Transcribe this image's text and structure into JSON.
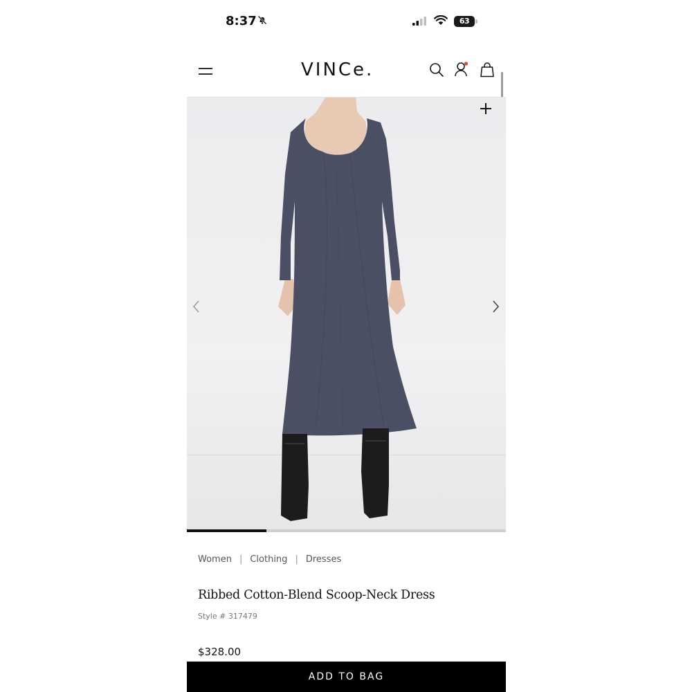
{
  "status_bar": {
    "time": "8:37",
    "battery": "63",
    "mute_icon": "bell-slash-icon",
    "signal_icon": "cellular-signal-icon",
    "wifi_icon": "wifi-icon"
  },
  "header": {
    "logo": "VINCe.",
    "menu_icon": "hamburger-menu-icon",
    "search_icon": "search-icon",
    "account_icon": "account-icon",
    "bag_icon": "shopping-bag-icon",
    "account_badge_color": "#e0443d"
  },
  "gallery": {
    "zoom_icon": "plus-icon",
    "prev_icon": "chevron-left-icon",
    "next_icon": "chevron-right-icon",
    "progress": 0.25,
    "dress_color": "#4a4f63"
  },
  "breadcrumb": [
    "Women",
    "Clothing",
    "Dresses"
  ],
  "product": {
    "title": "Ribbed Cotton-Blend Scoop-Neck Dress",
    "style": "Style # 317479",
    "price": "$328.00"
  },
  "cta": {
    "add_to_bag": "ADD TO BAG"
  }
}
